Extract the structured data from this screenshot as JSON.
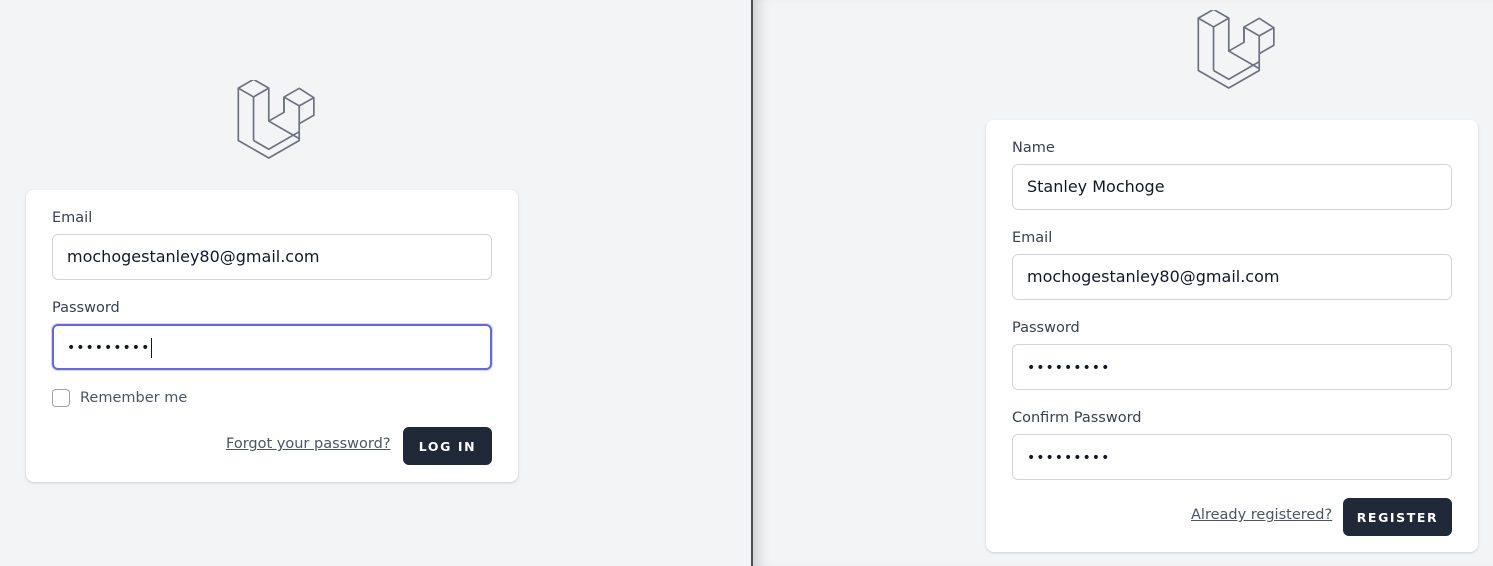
{
  "login": {
    "logo_icon": "laravel-logo-icon",
    "email_label": "Email",
    "email_value": "mochogestanley80@gmail.com",
    "password_label": "Password",
    "password_value": "•••••••••",
    "remember_label": "Remember me",
    "remember_checked": false,
    "forgot_link": "Forgot your password?",
    "submit_label": "LOG IN"
  },
  "register": {
    "logo_icon": "laravel-logo-icon",
    "name_label": "Name",
    "name_value": "Stanley Mochoge",
    "email_label": "Email",
    "email_value": "mochogestanley80@gmail.com",
    "password_label": "Password",
    "password_value": "•••••••••",
    "confirm_label": "Confirm Password",
    "confirm_value": "•••••••••",
    "already_link": "Already registered?",
    "submit_label": "REGISTER"
  },
  "colors": {
    "page_bg": "#f3f4f6",
    "button_bg": "#1f2937",
    "focus_ring": "#6366f1",
    "logo_stroke": "#6b7280"
  }
}
